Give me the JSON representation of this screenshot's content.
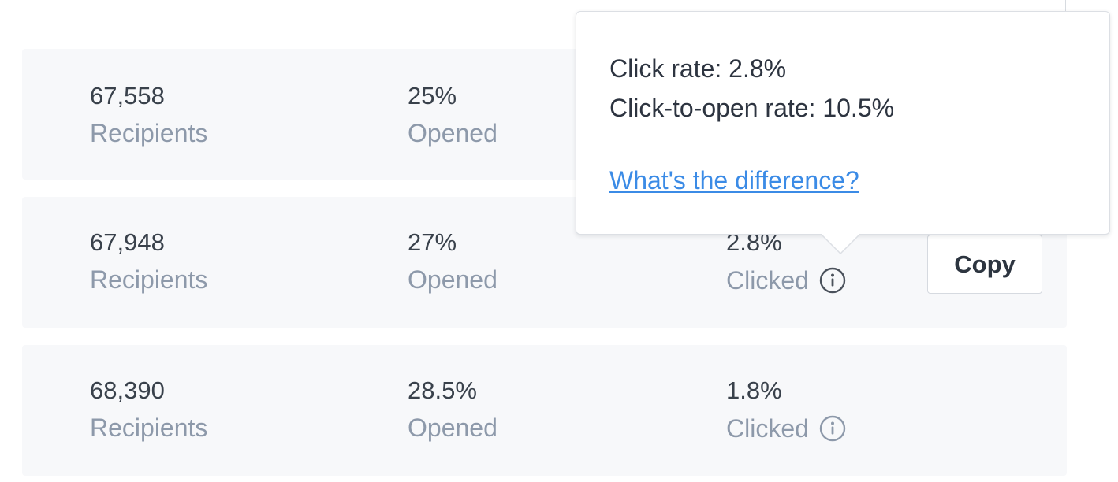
{
  "rows": [
    {
      "recipients": {
        "value": "67,558",
        "label": "Recipients"
      },
      "opened": {
        "value": "25%",
        "label": "Opened"
      }
    },
    {
      "recipients": {
        "value": "67,948",
        "label": "Recipients"
      },
      "opened": {
        "value": "27%",
        "label": "Opened"
      },
      "clicked": {
        "value": "2.8%",
        "label": "Clicked",
        "icon": "info-icon"
      },
      "copy_label": "Copy"
    },
    {
      "recipients": {
        "value": "68,390",
        "label": "Recipients"
      },
      "opened": {
        "value": "28.5%",
        "label": "Opened"
      },
      "clicked": {
        "value": "1.8%",
        "label": "Clicked",
        "icon": "info-icon"
      }
    }
  ],
  "tooltip": {
    "click_rate": "Click rate: 2.8%",
    "click_to_open_rate": "Click-to-open rate: 10.5%",
    "link_text": "What's the difference?"
  },
  "colors": {
    "row_background": "#f7f8fa",
    "value_text": "#39414b",
    "label_text": "#8d99aa",
    "link": "#3b8be6"
  }
}
